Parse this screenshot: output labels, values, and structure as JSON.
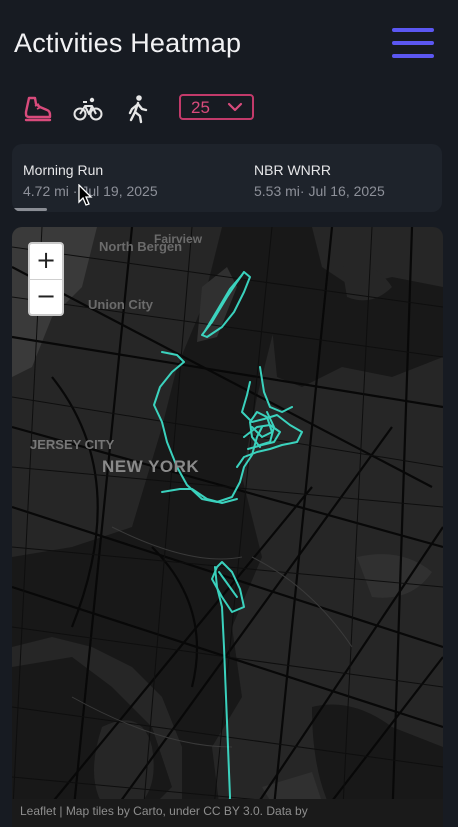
{
  "header": {
    "title": "Activities Heatmap",
    "menu_icon": "hamburger-menu-icon"
  },
  "filters": {
    "types": [
      {
        "id": "run",
        "icon": "running-shoe-icon",
        "active": true,
        "color": "#d94b7c"
      },
      {
        "id": "ride",
        "icon": "bicycle-icon",
        "active": false
      },
      {
        "id": "walk",
        "icon": "walking-person-icon",
        "active": false
      }
    ],
    "count": {
      "value": "25",
      "accent": "#c23a6a"
    }
  },
  "activities": [
    {
      "name": "Morning Run",
      "meta": "4.72 mi · Jul 19, 2025"
    },
    {
      "name": "NBR WNRR",
      "meta": "5.53 mi· Jul 16, 2025"
    }
  ],
  "map": {
    "zoom_in": "+",
    "zoom_out": "−",
    "labels": {
      "fairview": "Fairview",
      "north_bergen": "North Bergen",
      "union_city": "Union City",
      "jersey_city": "JERSEY CITY",
      "new_york": "NEW YORK"
    },
    "attribution": "Leaflet | Map tiles by Carto, under CC BY 3.0. Data by",
    "route_color": "#3ee6cf"
  }
}
